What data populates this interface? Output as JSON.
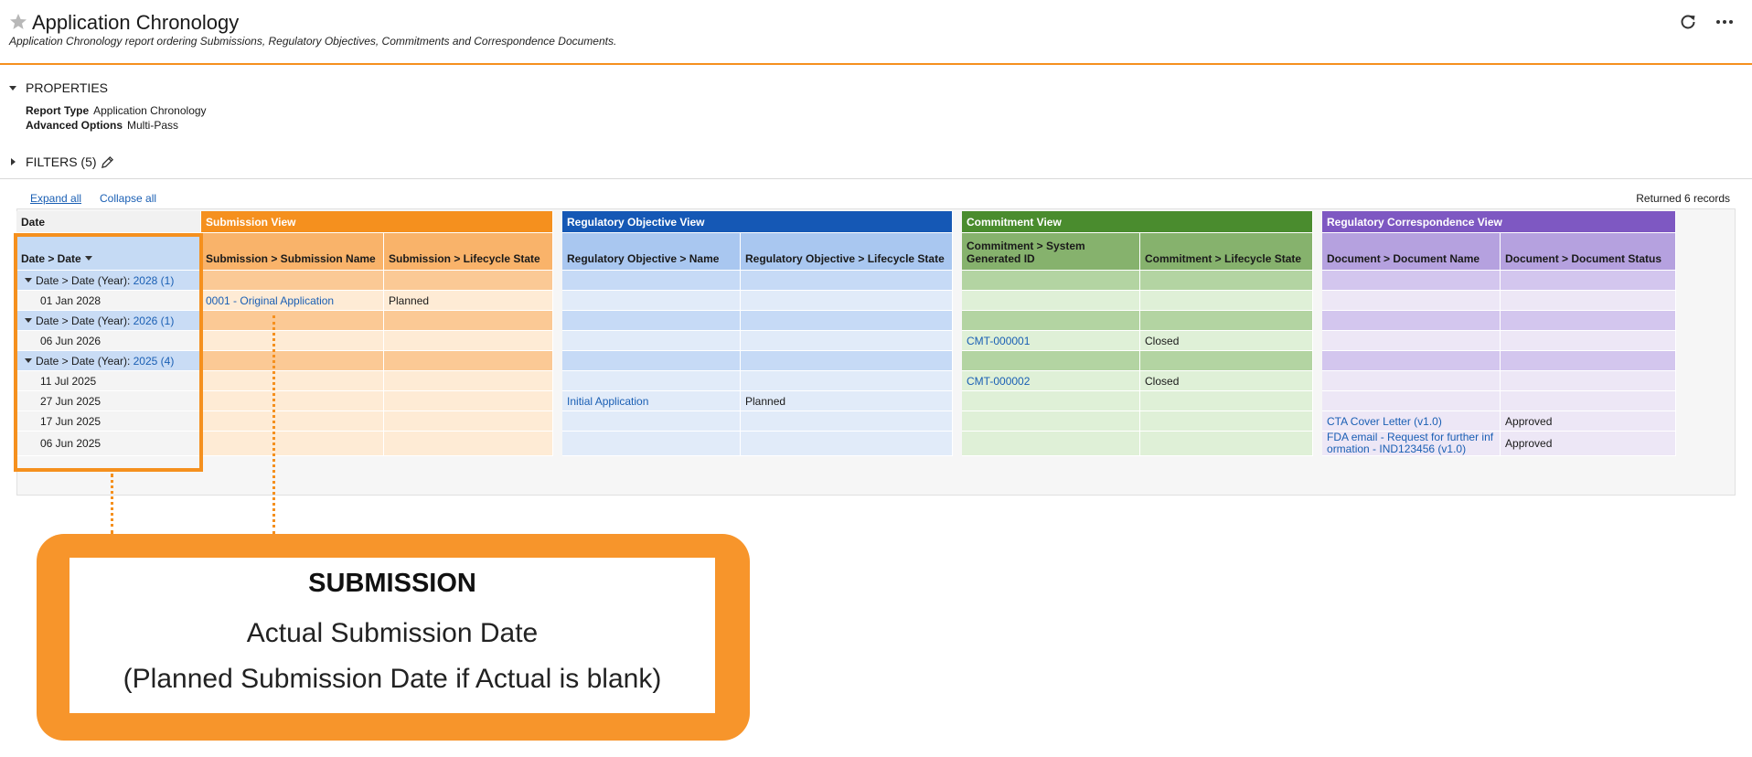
{
  "header": {
    "title": "Application Chronology",
    "subtitle": "Application Chronology report ordering Submissions, Regulatory Objectives, Commitments and Correspondence Documents."
  },
  "properties": {
    "label": "PROPERTIES",
    "report_type_label": "Report Type",
    "report_type_value": "Application Chronology",
    "advanced_label": "Advanced Options",
    "advanced_value": "Multi-Pass"
  },
  "filters": {
    "label": "FILTERS (5)"
  },
  "toolbar": {
    "expand_all": "Expand all",
    "collapse_all": "Collapse all",
    "returned": "Returned 6 records"
  },
  "groups": {
    "date": "Date",
    "submission": "Submission View",
    "regulatory": "Regulatory Objective View",
    "commitment": "Commitment View",
    "correspondence": "Regulatory Correspondence View"
  },
  "columns": {
    "date": "Date > Date",
    "sub_name": "Submission > Submission Name",
    "sub_state": "Submission > Lifecycle State",
    "reg_name": "Regulatory Objective > Name",
    "reg_state": "Regulatory Objective > Lifecycle State",
    "com_id": "Commitment > System Generated ID",
    "com_state": "Commitment > Lifecycle State",
    "doc_name": "Document > Document Name",
    "doc_status": "Document > Document Status"
  },
  "year_prefix": "Date > Date (Year):",
  "rows": {
    "y2028": {
      "year": "2028 (1)"
    },
    "r1": {
      "date": "01 Jan 2028",
      "sub_name": "0001 - Original Application",
      "sub_state": "Planned"
    },
    "y2026": {
      "year": "2026 (1)"
    },
    "r2": {
      "date": "06 Jun 2026",
      "com_id": "CMT-000001",
      "com_state": "Closed"
    },
    "y2025": {
      "year": "2025 (4)"
    },
    "r3": {
      "date": "11 Jul 2025",
      "com_id": "CMT-000002",
      "com_state": "Closed"
    },
    "r4": {
      "date": "27 Jun 2025",
      "reg_name": "Initial Application",
      "reg_state": "Planned"
    },
    "r5": {
      "date": "17 Jun 2025",
      "doc_name": "CTA Cover Letter (v1.0)",
      "doc_status": "Approved"
    },
    "r6": {
      "date": "06 Jun 2025",
      "doc_name": "FDA email - Request for further information - IND123456 (v1.0)",
      "doc_status": "Approved"
    }
  },
  "callout": {
    "title": "SUBMISSION",
    "line1": "Actual Submission Date",
    "line2": "(Planned Submission Date if Actual is blank)"
  },
  "colors": {
    "accent": "#f5901e",
    "submission": "#f5901e",
    "regulatory": "#1558b5",
    "commitment": "#4a8c2e",
    "correspondence": "#7e58c2",
    "link": "#1a5fb4"
  },
  "icons": {
    "favorite": "star-icon",
    "refresh": "refresh-icon",
    "more": "more-icon",
    "edit": "pencil-icon",
    "toggle": "caret-icon"
  }
}
